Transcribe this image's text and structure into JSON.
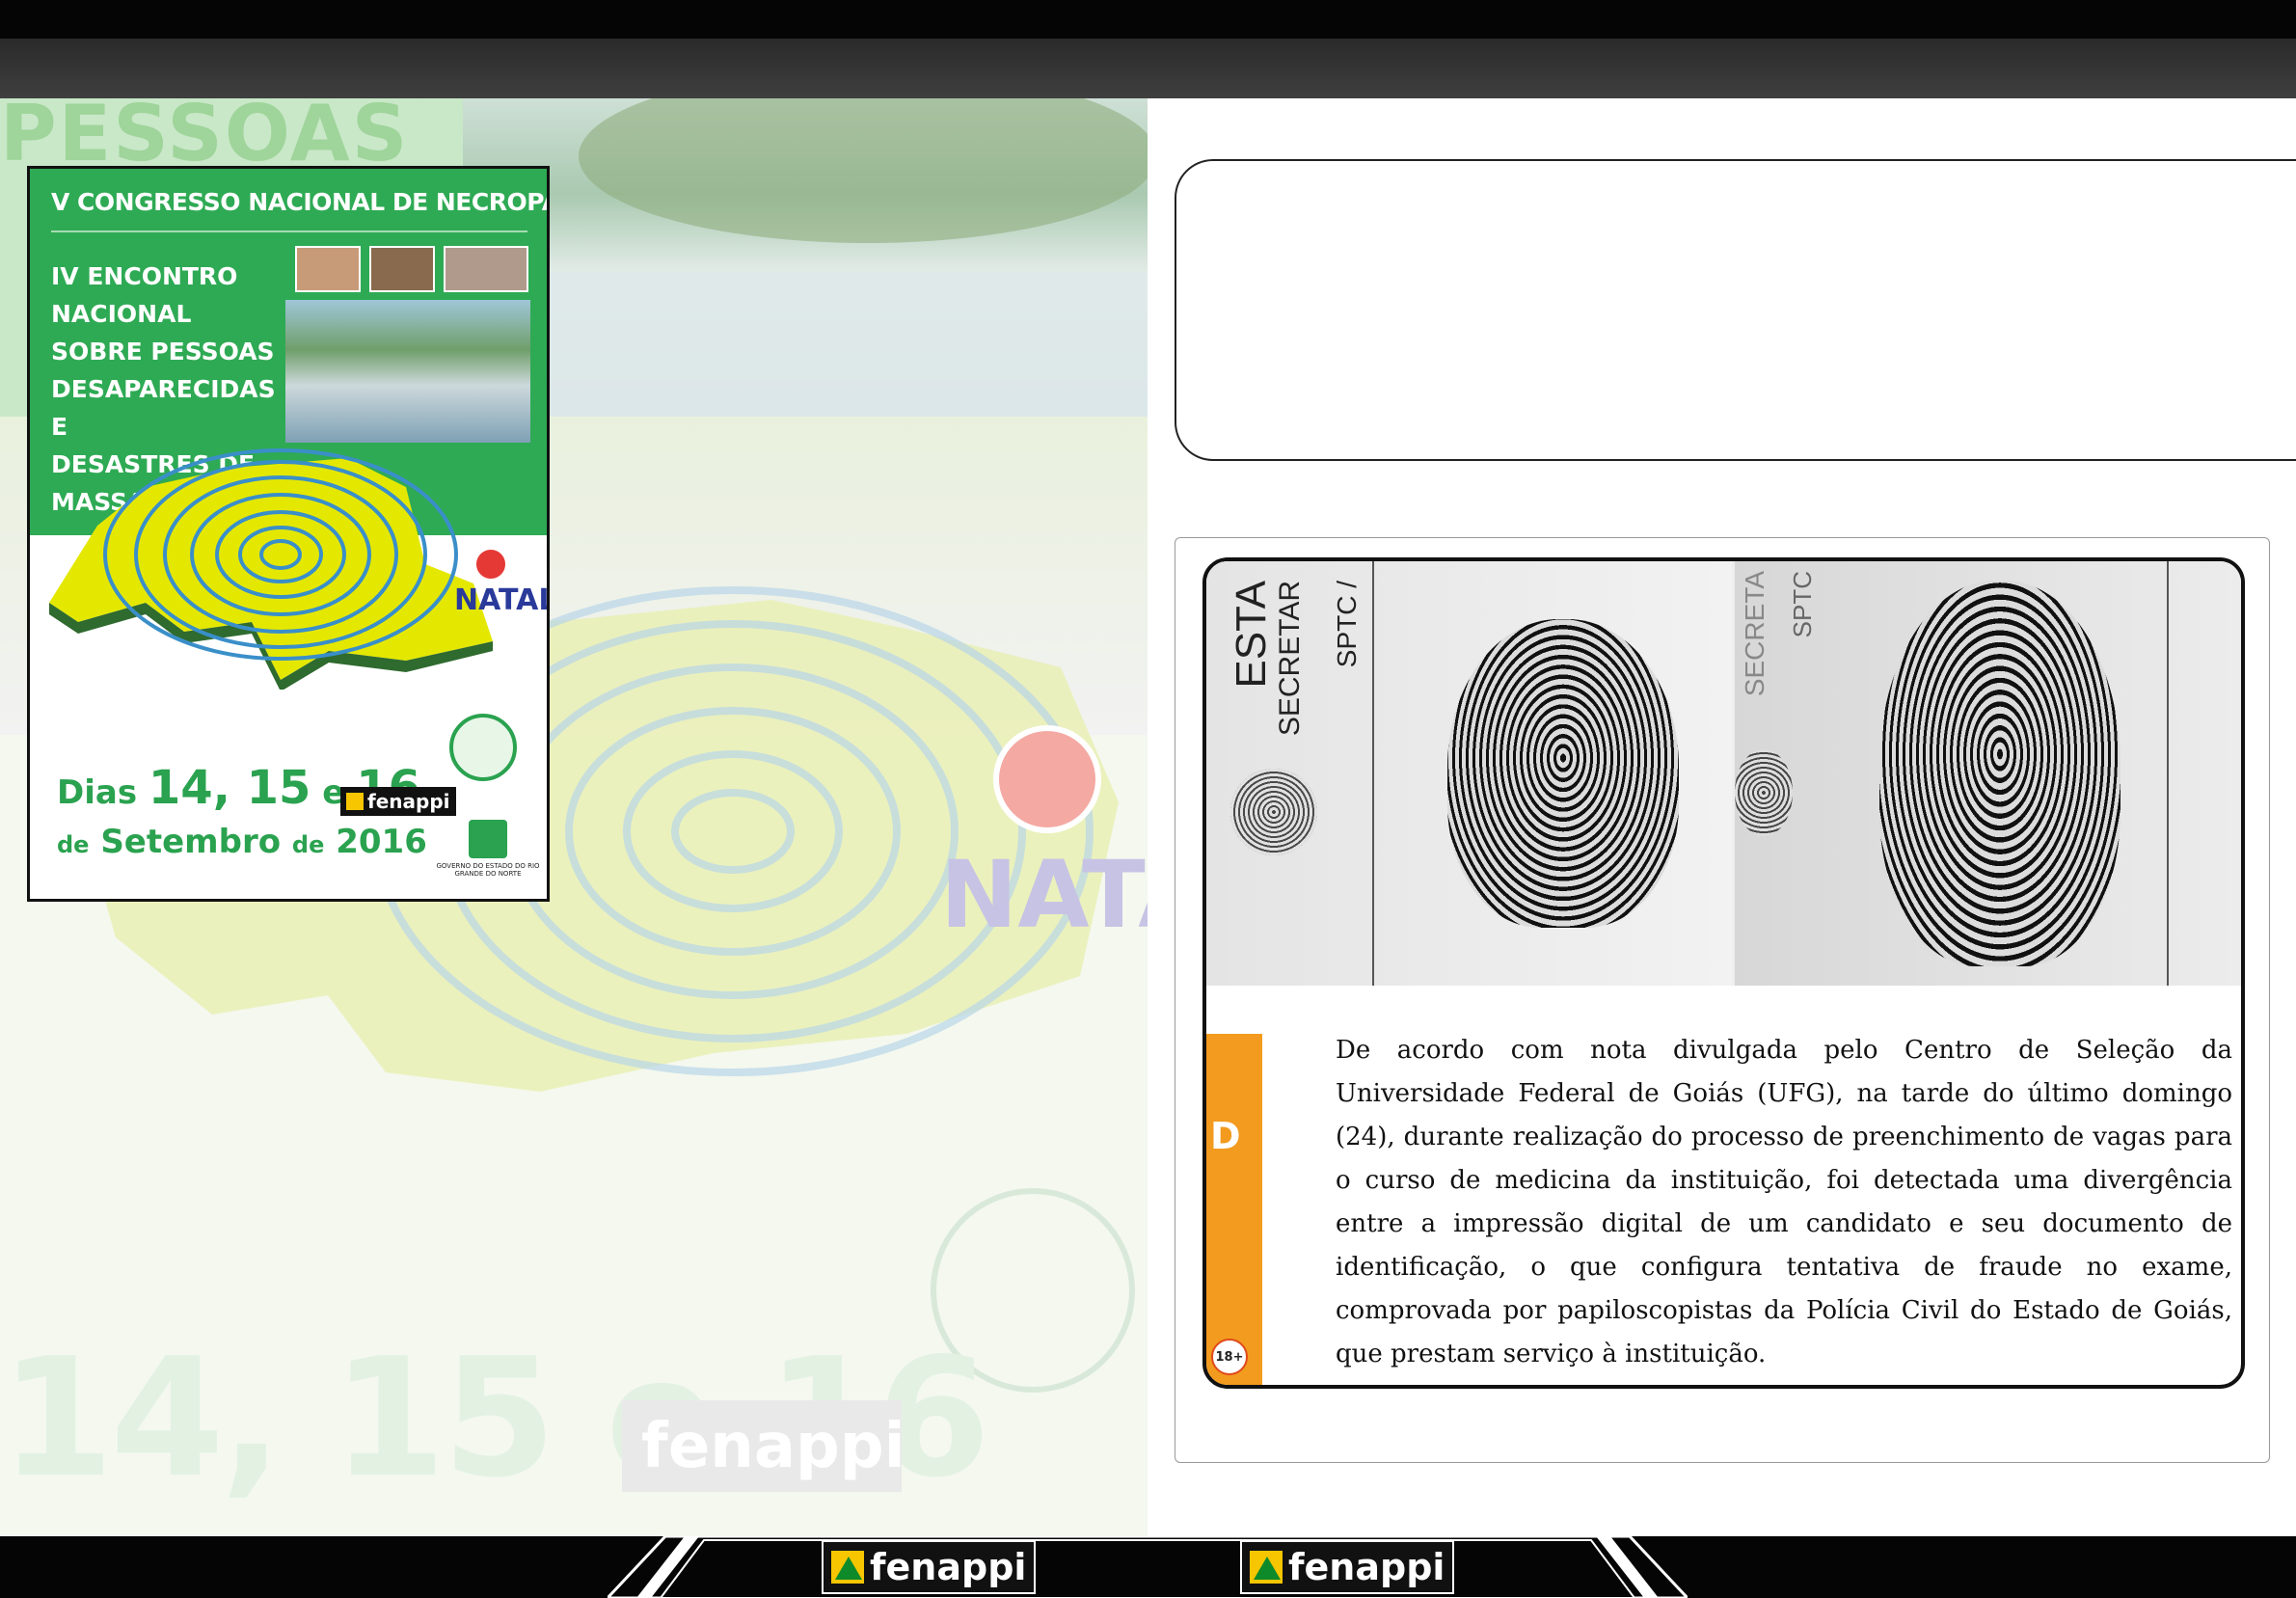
{
  "background": {
    "word_top": "PESSOAS",
    "natal_label": "NATAL",
    "dates_watermark": "14, 15 e 16",
    "fenappi_watermark": "fenappi"
  },
  "poster": {
    "title": "V CONGRESSO NACIONAL DE NECROPAPILOSCOPIA",
    "subtitle": "IV ENCONTRO\nNACIONAL\nSOBRE PESSOAS\nDESAPARECIDAS E\nDESASTRES DE MASSA",
    "natal_label": "NATAL",
    "dates_prefix": "Dias",
    "dates_days": "14, 15",
    "dates_e": "e",
    "dates_last": "16",
    "month_prefix": "de",
    "month": "Setembro",
    "year_prefix": "de",
    "year": "2016",
    "logo_text": "fenappi",
    "gov_text": "GOVERNO DO ESTADO DO RIO GRANDE DO NORTE"
  },
  "document": {
    "left_text_1": "ESTA",
    "left_text_2": "SECRETAR",
    "left_text_3": "SPTC /",
    "right_text_1": "SECRETA",
    "right_text_2": "SPTC"
  },
  "article": {
    "badge": "D",
    "age_rating": "18+",
    "body": "De acordo com nota divulgada pelo Centro de Seleção da Universidade Federal de Goiás (UFG), na tarde do último domingo (24), durante realização do processo de preenchimento de vagas para o curso de medicina da instituição, foi detectada uma divergência entre a impressão digital de um candidato e seu documento de identificação, o que configura tentativa de fraude no exame, comprovada por papiloscopistas da Polícia Civil do Estado de Goiás, que prestam serviço à instituição."
  },
  "footer": {
    "logo_left": "fenappi",
    "logo_right": "fenappi"
  },
  "colors": {
    "accent_green": "#2eaa54",
    "orange": "#f29b1f",
    "dark": "#050505"
  }
}
